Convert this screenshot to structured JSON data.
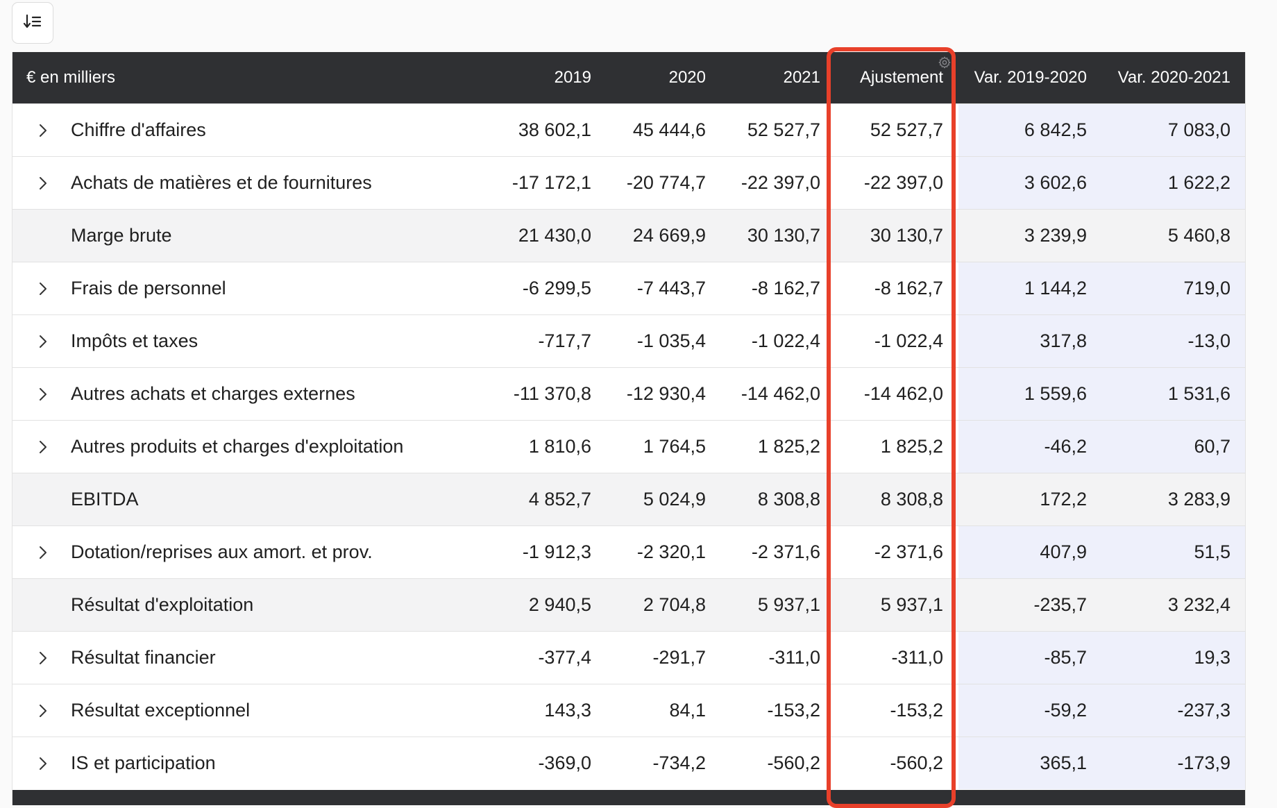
{
  "toolbar": {
    "sort_icon": "sort-descending-list-icon"
  },
  "table": {
    "headers": {
      "label": "€ en milliers",
      "y2019": "2019",
      "y2020": "2020",
      "y2021": "2021",
      "adjustment": "Ajustement",
      "var1": "Var. 2019-2020",
      "var2": "Var. 2020-2021"
    },
    "adjustment_settings_icon": "gear-icon",
    "highlight_color": "#e8402a",
    "rows": [
      {
        "label": "Chiffre d'affaires",
        "expandable": true,
        "y2019": "38 602,1",
        "y2020": "45 444,6",
        "y2021": "52 527,7",
        "adj": "52 527,7",
        "var1": "6 842,5",
        "var2": "7 083,0"
      },
      {
        "label": "Achats de matières et de fournitures",
        "expandable": true,
        "y2019": "-17 172,1",
        "y2020": "-20 774,7",
        "y2021": "-22 397,0",
        "adj": "-22 397,0",
        "var1": "3 602,6",
        "var2": "1 622,2"
      },
      {
        "label": "Marge brute",
        "expandable": false,
        "y2019": "21 430,0",
        "y2020": "24 669,9",
        "y2021": "30 130,7",
        "adj": "30 130,7",
        "var1": "3 239,9",
        "var2": "5 460,8"
      },
      {
        "label": "Frais de personnel",
        "expandable": true,
        "y2019": "-6 299,5",
        "y2020": "-7 443,7",
        "y2021": "-8 162,7",
        "adj": "-8 162,7",
        "var1": "1 144,2",
        "var2": "719,0"
      },
      {
        "label": "Impôts et taxes",
        "expandable": true,
        "y2019": "-717,7",
        "y2020": "-1 035,4",
        "y2021": "-1 022,4",
        "adj": "-1 022,4",
        "var1": "317,8",
        "var2": "-13,0"
      },
      {
        "label": "Autres achats et charges externes",
        "expandable": true,
        "y2019": "-11 370,8",
        "y2020": "-12 930,4",
        "y2021": "-14 462,0",
        "adj": "-14 462,0",
        "var1": "1 559,6",
        "var2": "1 531,6"
      },
      {
        "label": "Autres produits et charges d'exploitation",
        "expandable": true,
        "y2019": "1 810,6",
        "y2020": "1 764,5",
        "y2021": "1 825,2",
        "adj": "1 825,2",
        "var1": "-46,2",
        "var2": "60,7"
      },
      {
        "label": "EBITDA",
        "expandable": false,
        "y2019": "4 852,7",
        "y2020": "5 024,9",
        "y2021": "8 308,8",
        "adj": "8 308,8",
        "var1": "172,2",
        "var2": "3 283,9"
      },
      {
        "label": "Dotation/reprises aux amort. et prov.",
        "expandable": true,
        "y2019": "-1 912,3",
        "y2020": "-2 320,1",
        "y2021": "-2 371,6",
        "adj": "-2 371,6",
        "var1": "407,9",
        "var2": "51,5"
      },
      {
        "label": "Résultat d'exploitation",
        "expandable": false,
        "y2019": "2 940,5",
        "y2020": "2 704,8",
        "y2021": "5 937,1",
        "adj": "5 937,1",
        "var1": "-235,7",
        "var2": "3 232,4"
      },
      {
        "label": "Résultat financier",
        "expandable": true,
        "y2019": "-377,4",
        "y2020": "-291,7",
        "y2021": "-311,0",
        "adj": "-311,0",
        "var1": "-85,7",
        "var2": "19,3"
      },
      {
        "label": "Résultat exceptionnel",
        "expandable": true,
        "y2019": "143,3",
        "y2020": "84,1",
        "y2021": "-153,2",
        "adj": "-153,2",
        "var1": "-59,2",
        "var2": "-237,3"
      },
      {
        "label": "IS et participation",
        "expandable": true,
        "y2019": "-369,0",
        "y2020": "-734,2",
        "y2021": "-560,2",
        "adj": "-560,2",
        "var1": "365,1",
        "var2": "-173,9"
      }
    ]
  }
}
